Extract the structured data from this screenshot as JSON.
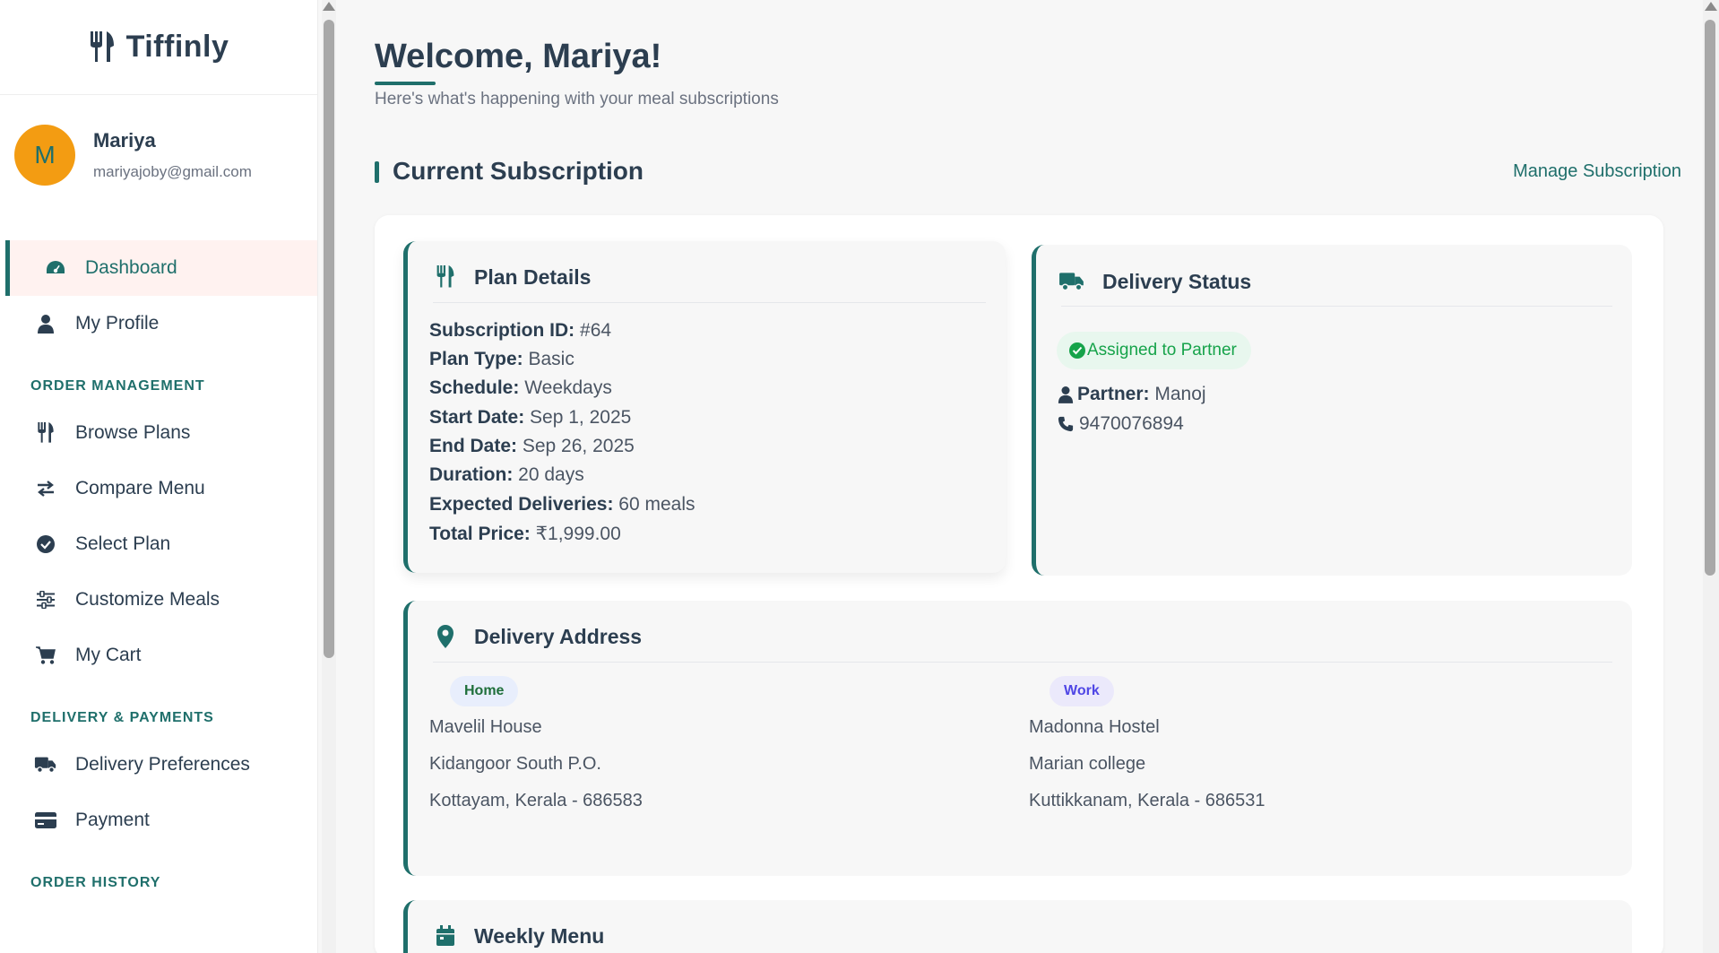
{
  "brand": {
    "name": "Tiffinly",
    "icon": "utensils-icon"
  },
  "user": {
    "initial": "M",
    "name": "Mariya",
    "email": "mariyajoby@gmail.com"
  },
  "nav": {
    "dashboard": "Dashboard",
    "profile": "My Profile",
    "section_order": "ORDER MANAGEMENT",
    "browse": "Browse Plans",
    "compare": "Compare Menu",
    "select": "Select Plan",
    "customize": "Customize Meals",
    "cart": "My Cart",
    "section_delivery": "DELIVERY & PAYMENTS",
    "delivery_prefs": "Delivery Preferences",
    "payment": "Payment",
    "section_history": "ORDER HISTORY"
  },
  "header": {
    "welcome": "Welcome, Mariya!",
    "subtitle": "Here's what's happening with your meal subscriptions"
  },
  "subscription": {
    "title": "Current Subscription",
    "manage_link": "Manage Subscription"
  },
  "plan": {
    "title": "Plan Details",
    "subscription_id_label": "Subscription ID:",
    "subscription_id": "#64",
    "plan_type_label": "Plan Type:",
    "plan_type": "Basic",
    "schedule_label": "Schedule:",
    "schedule": "Weekdays",
    "start_label": "Start Date:",
    "start": "Sep 1, 2025",
    "end_label": "End Date:",
    "end": "Sep 26, 2025",
    "duration_label": "Duration:",
    "duration": "20 days",
    "deliveries_label": "Expected Deliveries:",
    "deliveries": "60 meals",
    "price_label": "Total Price:",
    "price": "₹1,999.00"
  },
  "delivery": {
    "title": "Delivery Status",
    "status": "Assigned to Partner",
    "partner_label": "Partner:",
    "partner": "Manoj",
    "phone": "9470076894"
  },
  "address": {
    "title": "Delivery Address",
    "home": {
      "tag": "Home",
      "line1": "Mavelil House",
      "line2": "Kidangoor South P.O.",
      "line3": "Kottayam, Kerala - 686583"
    },
    "work": {
      "tag": "Work",
      "line1": "Madonna Hostel",
      "line2": "Marian college",
      "line3": "Kuttikkanam, Kerala - 686531"
    }
  },
  "menu": {
    "title": "Weekly Menu"
  },
  "colors": {
    "accent": "#1f6f6b",
    "avatar": "#f39c12",
    "success": "#16a34a"
  }
}
